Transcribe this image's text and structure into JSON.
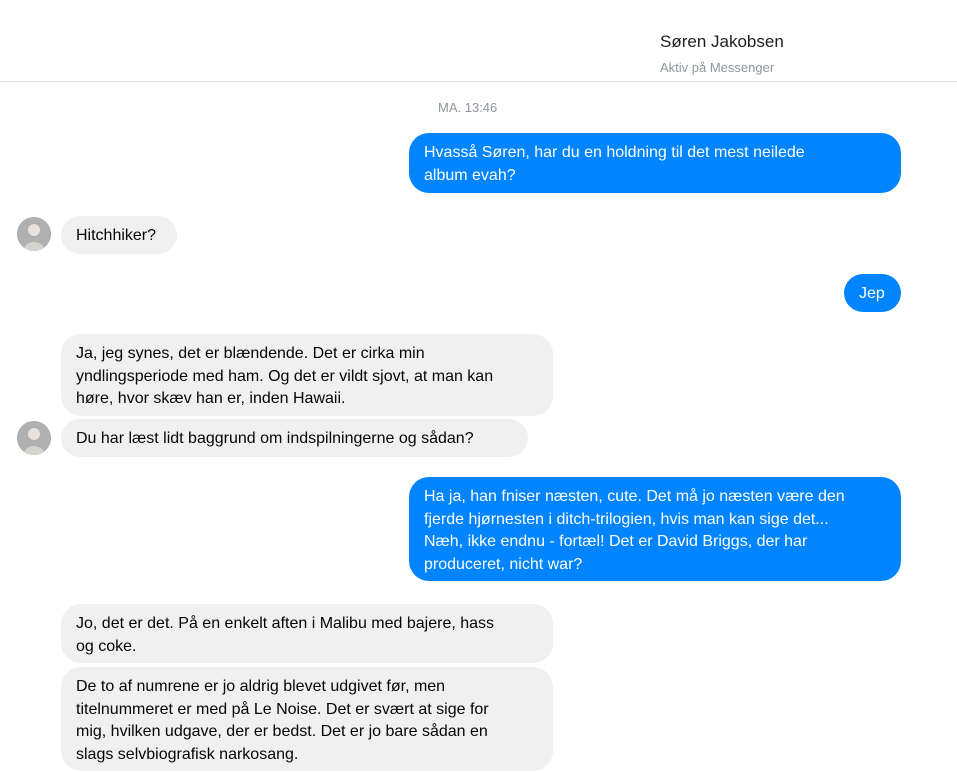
{
  "header": {
    "contact_name": "Søren Jakobsen",
    "contact_status": "Aktiv på Messenger"
  },
  "timestamp": "MA. 13:46",
  "messages": [
    {
      "from": "me",
      "text": "Hvasså Søren, har du en holdning til det mest neilede\nalbum evah?"
    },
    {
      "from": "contact",
      "text": "Hitchhiker?"
    },
    {
      "from": "me",
      "text": "Jep"
    },
    {
      "from": "contact",
      "text": "Ja, jeg synes, det er blændende. Det er cirka min\nyndlingsperiode med ham. Og det er vildt sjovt, at man kan\nhøre, hvor skæv han er, inden Hawaii."
    },
    {
      "from": "contact",
      "text": "Du har læst lidt baggrund om indspilningerne og sådan?"
    },
    {
      "from": "me",
      "text": "Ha ja, han fniser næsten, cute. Det må jo næsten være den\nfjerde hjørnesten i ditch-trilogien, hvis man kan sige det...\nNæh, ikke endnu - fortæl! Det er David Briggs, der har\nproduceret, nicht war?"
    },
    {
      "from": "contact",
      "text": "Jo, det er det. På en enkelt aften i Malibu med bajere, hass\nog coke."
    },
    {
      "from": "contact",
      "text": "De to af numrene er jo aldrig blevet udgivet før, men\ntitelnummeret er med på Le Noise. Det er svært at sige for\nmig, hvilken udgave, der er bedst. Det er jo bare sådan en\nslags selvbiografisk narkosang."
    }
  ],
  "colors": {
    "outgoing_bubble": "#0084ff",
    "incoming_bubble": "#f1f0f0",
    "meta_text": "#90949c"
  }
}
